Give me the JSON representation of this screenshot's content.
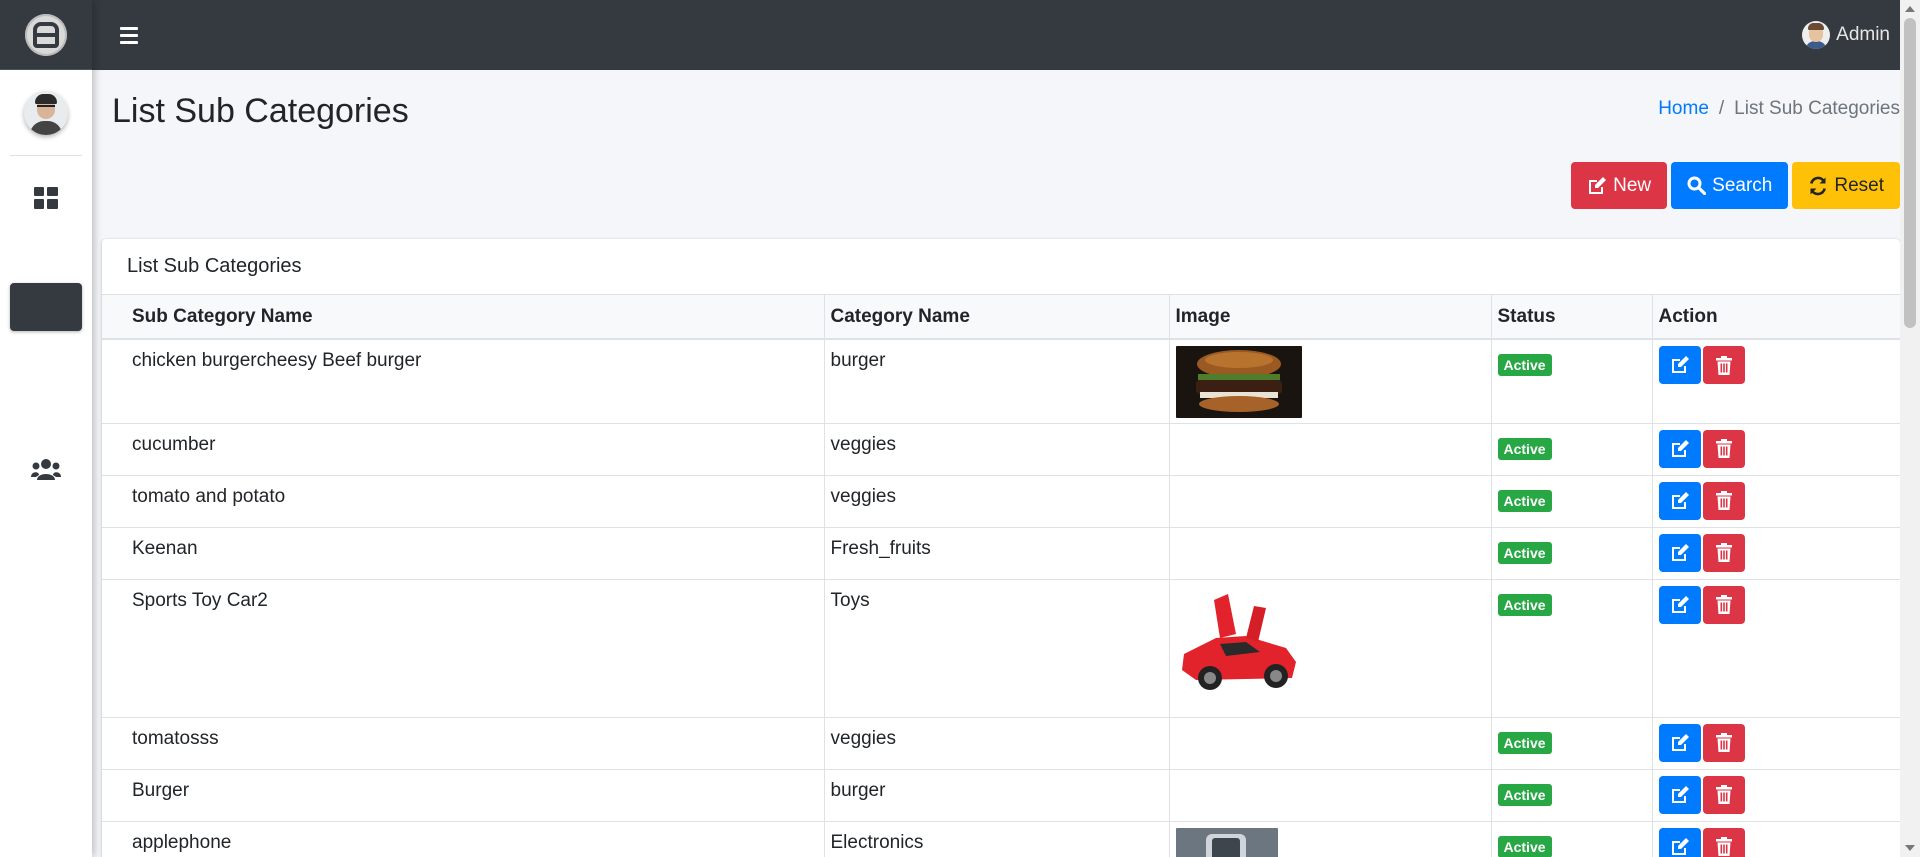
{
  "topbar": {
    "user_name": "Admin"
  },
  "page": {
    "title": "List Sub Categories"
  },
  "breadcrumb": {
    "home": "Home",
    "current": "List Sub Categories"
  },
  "toolbar": {
    "new_label": "New",
    "search_label": "Search",
    "reset_label": "Reset"
  },
  "card": {
    "title": "List Sub Categories"
  },
  "table": {
    "headers": [
      "Sub Category Name",
      "Category Name",
      "Image",
      "Status",
      "Action"
    ],
    "rows": [
      {
        "name": "chicken burgercheesy Beef burger",
        "category": "burger",
        "image": "burger",
        "status": "Active"
      },
      {
        "name": "cucumber",
        "category": "veggies",
        "image": "",
        "status": "Active"
      },
      {
        "name": "tomato and potato",
        "category": "veggies",
        "image": "",
        "status": "Active"
      },
      {
        "name": "Keenan",
        "category": "Fresh_fruits",
        "image": "",
        "status": "Active"
      },
      {
        "name": "Sports Toy Car2",
        "category": "Toys",
        "image": "car",
        "status": "Active"
      },
      {
        "name": "tomatosss",
        "category": "veggies",
        "image": "",
        "status": "Active"
      },
      {
        "name": "Burger",
        "category": "burger",
        "image": "",
        "status": "Active"
      },
      {
        "name": "applephone",
        "category": "Electronics",
        "image": "phone",
        "status": "Active"
      }
    ]
  },
  "icons": {
    "menu": "hamburger-icon",
    "dashboard": "dashboard-icon",
    "users": "users-icon",
    "edit": "edit-icon",
    "delete": "trash-icon",
    "search": "search-icon",
    "reset": "sync-icon",
    "new": "edit-icon"
  },
  "colors": {
    "navbar": "#343a40",
    "primary": "#007bff",
    "danger": "#dc3545",
    "warning": "#ffc107",
    "success": "#28a745"
  }
}
